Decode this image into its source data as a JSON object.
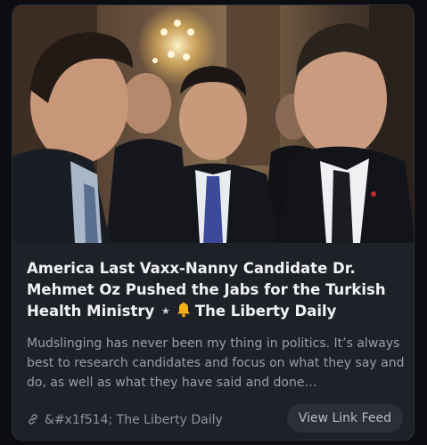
{
  "card": {
    "title_main": "America Last Vaxx-Nanny Candidate Dr. Mehmet Oz Pushed the Jabs for the Turkish Health Ministry",
    "title_star": "★",
    "title_source": "The Liberty Daily",
    "description": "Mudslinging has never been my thing in politics. It’s always best to research candidates and focus on what they say and do, as well as what they have said and done…",
    "source_label": "&#x1f514; The Liberty Daily",
    "view_button_label": "View Link Feed",
    "icons": {
      "bell": "bell-icon",
      "link": "link-icon"
    },
    "colors": {
      "background": "#0c0d10",
      "card": "#1e2128",
      "title": "#f1f2f4",
      "description": "#9a9ea6",
      "bell": "#f5b21b"
    }
  }
}
